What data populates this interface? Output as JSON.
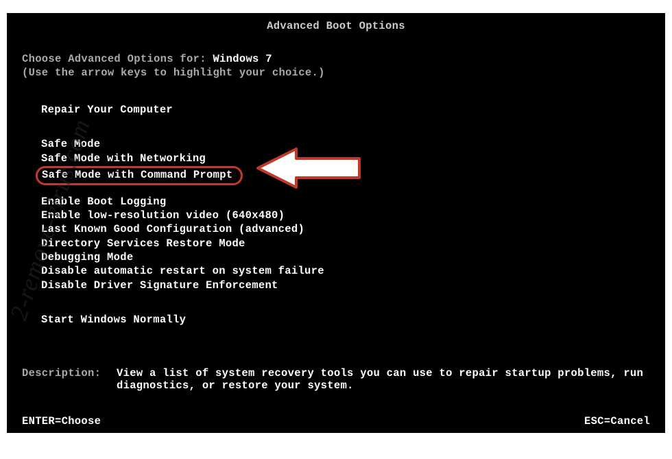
{
  "title": "Advanced Boot Options",
  "choose_prefix": "Choose Advanced Options for: ",
  "os_name": "Windows 7",
  "hint": "(Use the arrow keys to highlight your choice.)",
  "repair": "Repair Your Computer",
  "safe_modes": [
    "Safe Mode",
    "Safe Mode with Networking",
    "Safe Mode with Command Prompt"
  ],
  "options": [
    "Enable Boot Logging",
    "Enable low-resolution video (640x480)",
    "Last Known Good Configuration (advanced)",
    "Directory Services Restore Mode",
    "Debugging Mode",
    "Disable automatic restart on system failure",
    "Disable Driver Signature Enforcement"
  ],
  "start_normal": "Start Windows Normally",
  "description_label": "Description:",
  "description_text": "View a list of system recovery tools you can use to repair startup problems, run diagnostics, or restore your system.",
  "footer_left": "ENTER=Choose",
  "footer_right": "ESC=Cancel",
  "watermark": "2-remove-virus.com",
  "highlight_color": "#c0392b"
}
